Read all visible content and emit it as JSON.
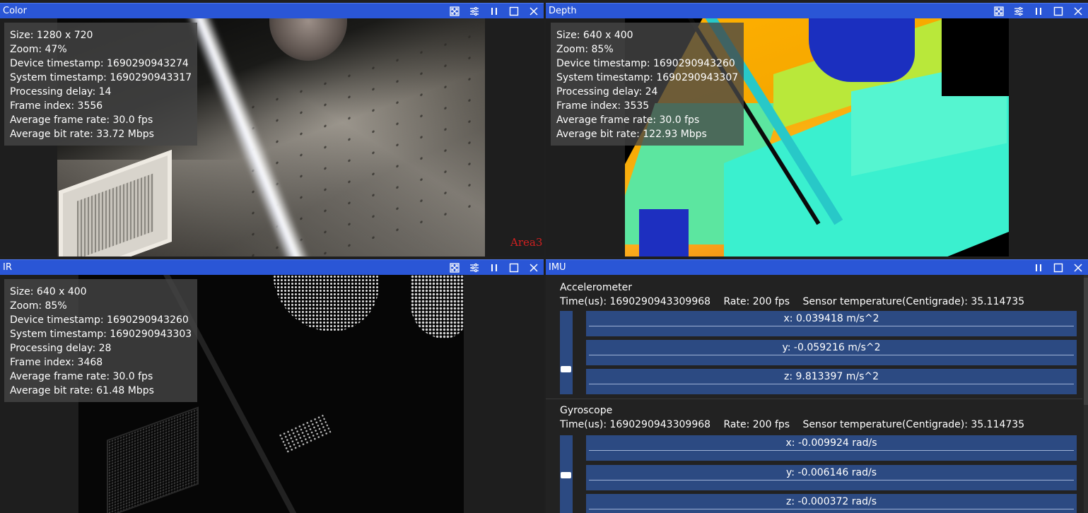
{
  "panels": {
    "color": {
      "title": "Color",
      "info": {
        "size": "Size: 1280 x 720",
        "zoom": "Zoom: 47%",
        "device_ts": "Device timestamp: 1690290943274",
        "system_ts": "System timestamp: 1690290943317",
        "delay": "Processing delay: 14",
        "frame": "Frame index: 3556",
        "fps": "Average frame rate: 30.0 fps",
        "bitrate": "Average bit rate: 33.72 Mbps"
      },
      "overlay_label": "Area3"
    },
    "depth": {
      "title": "Depth",
      "info": {
        "size": "Size: 640 x 400",
        "zoom": "Zoom: 85%",
        "device_ts": "Device timestamp: 1690290943260",
        "system_ts": "System timestamp: 1690290943307",
        "delay": "Processing delay: 24",
        "frame": "Frame index: 3535",
        "fps": "Average frame rate: 30.0 fps",
        "bitrate": "Average bit rate: 122.93 Mbps"
      }
    },
    "ir": {
      "title": "IR",
      "info": {
        "size": "Size: 640 x 400",
        "zoom": "Zoom: 85%",
        "device_ts": "Device timestamp: 1690290943260",
        "system_ts": "System timestamp: 1690290943303",
        "delay": "Processing delay: 28",
        "frame": "Frame index: 3468",
        "fps": "Average frame rate: 30.0 fps",
        "bitrate": "Average bit rate: 61.48 Mbps"
      }
    },
    "imu": {
      "title": "IMU",
      "accelerometer": {
        "name": "Accelerometer",
        "time": "Time(us): 1690290943309968",
        "rate": "Rate: 200 fps",
        "temp": "Sensor temperature(Centigrade): 35.114735",
        "x": "x: 0.039418 m/s^2",
        "y": "y: -0.059216 m/s^2",
        "z": "z: 9.813397 m/s^2"
      },
      "gyroscope": {
        "name": "Gyroscope",
        "time": "Time(us): 1690290943309968",
        "rate": "Rate: 200 fps",
        "temp": "Sensor temperature(Centigrade): 35.114735",
        "x": "x: -0.009924 rad/s",
        "y": "y: -0.006146 rad/s",
        "z": "z: -0.000372 rad/s"
      }
    }
  },
  "icons": {
    "fullscreen": "fullscreen-icon",
    "settings": "settings-icon",
    "pause": "pause-icon",
    "maximize": "maximize-icon",
    "close": "close-icon"
  },
  "colors": {
    "titlebar": "#2a56d6",
    "imu_row": "#2c4a82",
    "area_label": "#d02020"
  }
}
